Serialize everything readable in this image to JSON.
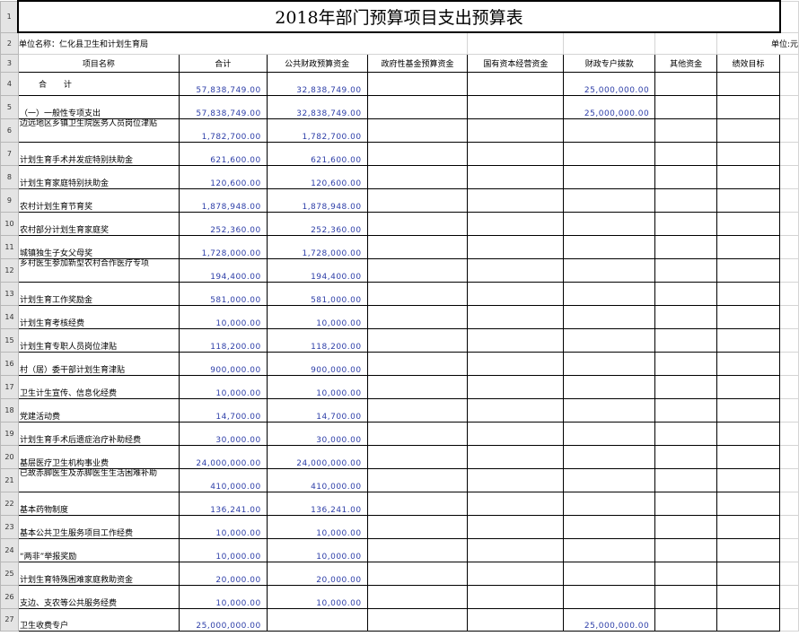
{
  "title": "2018年部门预算项目支出预算表",
  "unit_name": "单位名称：仁化县卫生和计划生育局",
  "unit_label": "单位:元",
  "headers": [
    "项目名称",
    "合计",
    "公共财政预算资金",
    "政府性基金预算资金",
    "国有资本经营资金",
    "财政专户拨款",
    "其他资金",
    "绩效目标"
  ],
  "rows": [
    {
      "num": "4",
      "name": "合  计",
      "total": "57,838,749.00",
      "public": "32,838,749.00",
      "special": "25,000,000.00"
    },
    {
      "num": "5",
      "name": "（一）一般性专项支出",
      "total": "57,838,749.00",
      "public": "32,838,749.00",
      "special": "25,000,000.00"
    },
    {
      "num": "6",
      "name": "边远地区乡镇卫生院医务人员岗位津贴",
      "total": "1,782,700.00",
      "public": "1,782,700.00",
      "special": ""
    },
    {
      "num": "7",
      "name": "计划生育手术并发症特别扶助金",
      "total": "621,600.00",
      "public": "621,600.00",
      "special": ""
    },
    {
      "num": "8",
      "name": "计划生育家庭特别扶助金",
      "total": "120,600.00",
      "public": "120,600.00",
      "special": ""
    },
    {
      "num": "9",
      "name": "农村计划生育节育奖",
      "total": "1,878,948.00",
      "public": "1,878,948.00",
      "special": ""
    },
    {
      "num": "10",
      "name": "农村部分计划生育家庭奖",
      "total": "252,360.00",
      "public": "252,360.00",
      "special": ""
    },
    {
      "num": "11",
      "name": "城镇独生子女父母奖",
      "total": "1,728,000.00",
      "public": "1,728,000.00",
      "special": ""
    },
    {
      "num": "12",
      "name": "乡村医生参加新型农村合作医疗专项",
      "total": "194,400.00",
      "public": "194,400.00",
      "special": ""
    },
    {
      "num": "13",
      "name": "计划生育工作奖励金",
      "total": "581,000.00",
      "public": "581,000.00",
      "special": ""
    },
    {
      "num": "14",
      "name": "计划生育考核经费",
      "total": "10,000.00",
      "public": "10,000.00",
      "special": ""
    },
    {
      "num": "15",
      "name": "计划生育专职人员岗位津贴",
      "total": "118,200.00",
      "public": "118,200.00",
      "special": ""
    },
    {
      "num": "16",
      "name": "村（居）委干部计划生育津贴",
      "total": "900,000.00",
      "public": "900,000.00",
      "special": ""
    },
    {
      "num": "17",
      "name": "卫生计生宣传、信息化经费",
      "total": "10,000.00",
      "public": "10,000.00",
      "special": ""
    },
    {
      "num": "18",
      "name": "党建活动费",
      "total": "14,700.00",
      "public": "14,700.00",
      "special": ""
    },
    {
      "num": "19",
      "name": "计划生育手术后遗症治疗补助经费",
      "total": "30,000.00",
      "public": "30,000.00",
      "special": ""
    },
    {
      "num": "20",
      "name": "基层医疗卫生机构事业费",
      "total": "24,000,000.00",
      "public": "24,000,000.00",
      "special": ""
    },
    {
      "num": "21",
      "name": "已故赤脚医生及赤脚医生生活困难补助",
      "total": "410,000.00",
      "public": "410,000.00",
      "special": ""
    },
    {
      "num": "22",
      "name": "基本药物制度",
      "total": "136,241.00",
      "public": "136,241.00",
      "special": ""
    },
    {
      "num": "23",
      "name": "基本公共卫生服务项目工作经费",
      "total": "10,000.00",
      "public": "10,000.00",
      "special": ""
    },
    {
      "num": "24",
      "name": "“两非”举报奖励",
      "total": "10,000.00",
      "public": "10,000.00",
      "special": ""
    },
    {
      "num": "25",
      "name": "计划生育特殊困难家庭救助资金",
      "total": "20,000.00",
      "public": "20,000.00",
      "special": ""
    },
    {
      "num": "26",
      "name": "支边、支农等公共服务经费",
      "total": "10,000.00",
      "public": "10,000.00",
      "special": ""
    },
    {
      "num": "27",
      "name": "卫生收费专户",
      "total": "25,000,000.00",
      "public": "",
      "special": "25,000,000.00"
    }
  ]
}
